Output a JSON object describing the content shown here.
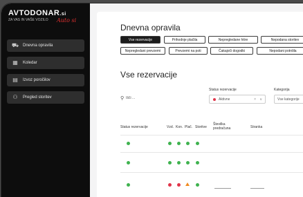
{
  "brand": {
    "name": "AVTODONAR",
    "suffix": ".si",
    "tagline": "ZA VAS IN VAŠE VOZILO",
    "script": "Auto si"
  },
  "sidebar": {
    "items": [
      {
        "label": "Dnevna opravila",
        "icon": "car-icon"
      },
      {
        "label": "Koledar",
        "icon": "calendar-icon"
      },
      {
        "label": "Izvoz poročilov",
        "icon": "report-icon"
      },
      {
        "label": "Pregled storitev",
        "icon": "handshake-icon"
      }
    ]
  },
  "daily": {
    "title": "Dnevna opravila",
    "buttons_row1": [
      "Vse rezervacije",
      "Prihodnje plačila",
      "Nepregledane hitre",
      "Nepodana storitev"
    ],
    "buttons_row2": [
      "Nepregledani prevzemi",
      "Prevzemi na poti",
      "Čakajoči dogodki",
      "Nepodani potrdila"
    ]
  },
  "reservations": {
    "title": "Vse rezervacije",
    "search_placeholder": "Išči ...",
    "status_label": "Status rezervacije",
    "status_value": "Aktivne",
    "status_clear": "×",
    "status_caret": "∨",
    "category_label": "Kategorija",
    "category_value": "Vse kategorije",
    "columns": [
      "Status rezervacije",
      "Vzd.",
      "Kon.",
      "Plač.",
      "Storitve",
      "Številka predračuna",
      "Stranka"
    ]
  },
  "colors": {
    "green": "#3fb24f",
    "red": "#e0354a",
    "orange": "#f08a20",
    "sidebar": "#0d0d0d"
  }
}
